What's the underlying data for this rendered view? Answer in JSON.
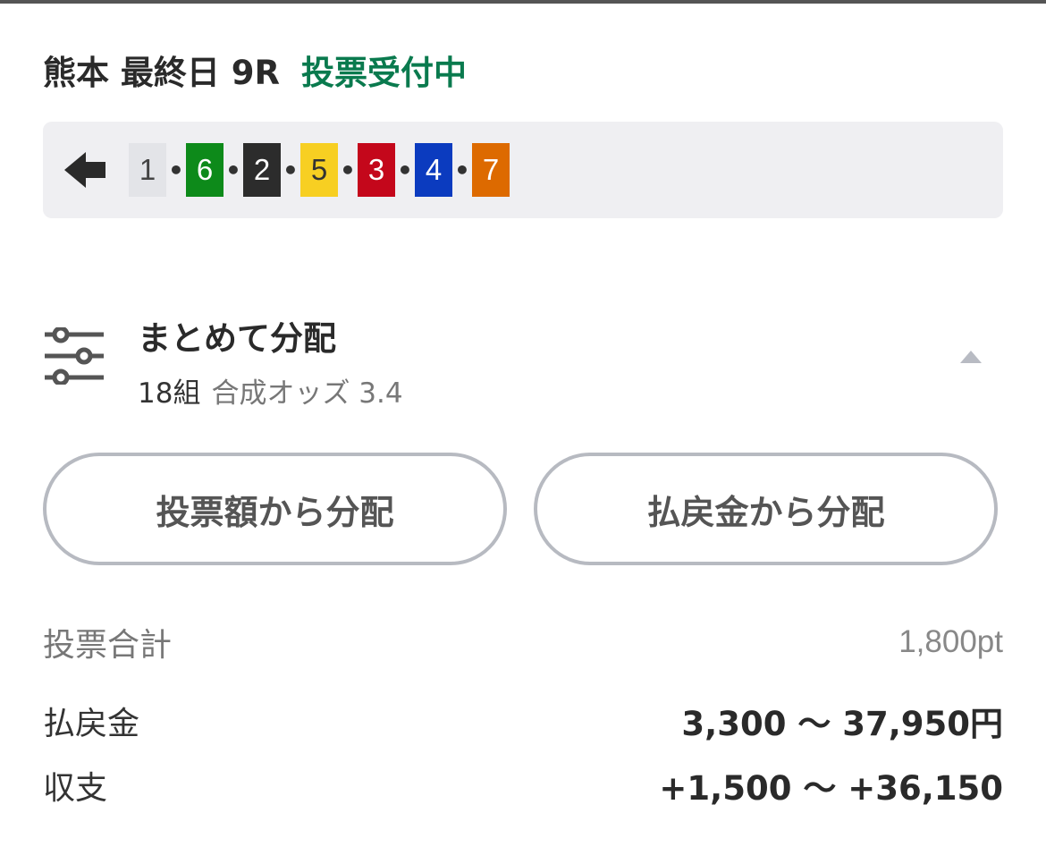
{
  "header": {
    "race_name": "熊本 最終日 9R",
    "status": "投票受付中",
    "status_color": "#0a7a4e"
  },
  "combination": {
    "direction_icon": "arrow-left-icon",
    "numbers": [
      {
        "label": "1",
        "bg": "#e3e4e8",
        "fg": "#444444"
      },
      {
        "label": "6",
        "bg": "#0d8a1a",
        "fg": "#ffffff"
      },
      {
        "label": "2",
        "bg": "#2c2c2c",
        "fg": "#ffffff"
      },
      {
        "label": "5",
        "bg": "#f7cf22",
        "fg": "#333333"
      },
      {
        "label": "3",
        "bg": "#c4071b",
        "fg": "#ffffff"
      },
      {
        "label": "4",
        "bg": "#0b3bbf",
        "fg": "#ffffff"
      },
      {
        "label": "7",
        "bg": "#dd6a00",
        "fg": "#ffffff"
      }
    ],
    "separator": "•"
  },
  "distribution": {
    "icon": "sliders-icon",
    "title": "まとめて分配",
    "count": "18組",
    "odds_text": "合成オッズ 3.4",
    "toggle_icon": "chevron-up-icon"
  },
  "buttons": {
    "by_bet": "投票額から分配",
    "by_payout": "払戻金から分配"
  },
  "summary": {
    "total_label": "投票合計",
    "total_value": "1,800pt",
    "payout_label": "払戻金",
    "payout_value": "3,300 〜 37,950円",
    "balance_label": "収支",
    "balance_value": "+1,500 〜 +36,150"
  }
}
